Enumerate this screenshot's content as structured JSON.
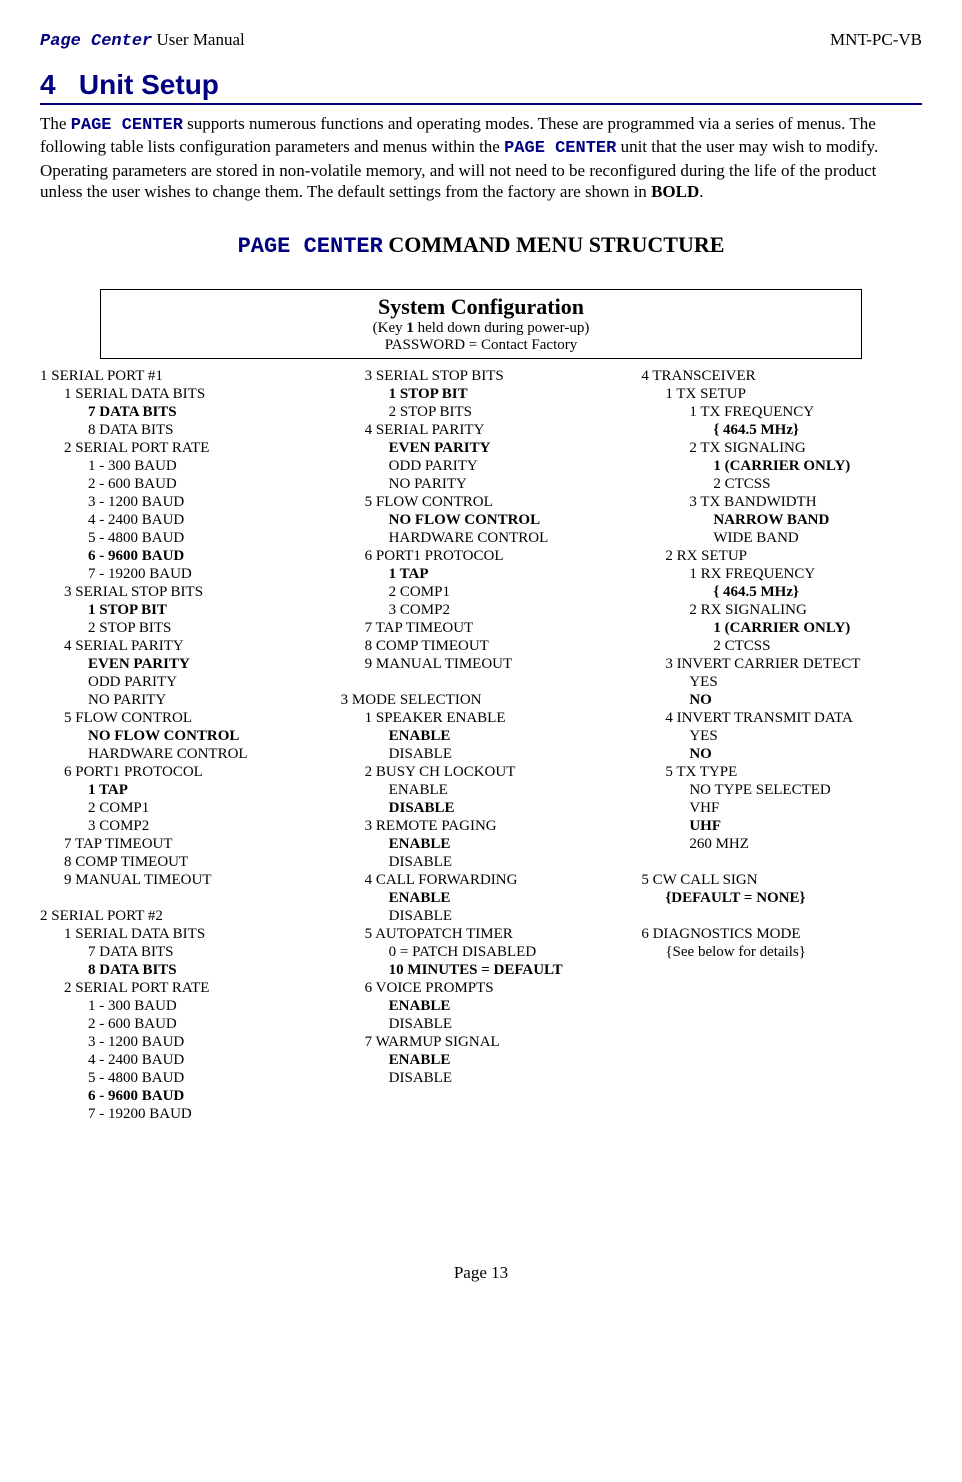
{
  "header": {
    "left_pc": "Page Center",
    "left_rest": " User Manual",
    "right": "MNT-PC-VB"
  },
  "section": {
    "number": "4",
    "title": "Unit Setup"
  },
  "intro": {
    "t1": "The ",
    "pc1": "PAGE CENTER",
    "t2": " supports numerous functions and operating modes.  These are programmed via a series of menus.  The following table lists configuration parameters and menus within the ",
    "pc2": "PAGE CENTER",
    "t3": " unit that the user may wish to modify.  Operating parameters are stored in non-volatile memory, and will not need to be reconfigured during the life of the product unless the user wishes to change them.  The default settings from the factory are shown in ",
    "bold": "BOLD",
    "t4": "."
  },
  "menu_title": {
    "pc": "PAGE CENTER",
    "rest": " COMMAND MENU STRUCTURE"
  },
  "sysconf": {
    "title": "System Configuration",
    "sub1a": "(Key ",
    "sub1b": "1",
    "sub1c": " held down during power-up)",
    "sub2": "PASSWORD = Contact Factory"
  },
  "columns": [
    [
      {
        "lvl": 0,
        "b": 0,
        "t": "1 SERIAL PORT #1"
      },
      {
        "lvl": 1,
        "b": 0,
        "t": "1 SERIAL DATA BITS"
      },
      {
        "lvl": 2,
        "b": 1,
        "t": "7 DATA BITS"
      },
      {
        "lvl": 2,
        "b": 0,
        "t": "8 DATA BITS"
      },
      {
        "lvl": 1,
        "b": 0,
        "t": "2 SERIAL PORT RATE"
      },
      {
        "lvl": 2,
        "b": 0,
        "t": "1 - 300 BAUD"
      },
      {
        "lvl": 2,
        "b": 0,
        "t": "2 - 600 BAUD"
      },
      {
        "lvl": 2,
        "b": 0,
        "t": "3 - 1200 BAUD"
      },
      {
        "lvl": 2,
        "b": 0,
        "t": "4 - 2400 BAUD"
      },
      {
        "lvl": 2,
        "b": 0,
        "t": "5 - 4800 BAUD"
      },
      {
        "lvl": 2,
        "b": 1,
        "t": "6 - 9600 BAUD"
      },
      {
        "lvl": 2,
        "b": 0,
        "t": "7 - 19200 BAUD"
      },
      {
        "lvl": 1,
        "b": 0,
        "t": "3 SERIAL STOP BITS"
      },
      {
        "lvl": 2,
        "b": 1,
        "t": "1 STOP BIT"
      },
      {
        "lvl": 2,
        "b": 0,
        "t": "2 STOP BITS"
      },
      {
        "lvl": 1,
        "b": 0,
        "t": "4 SERIAL PARITY"
      },
      {
        "lvl": 2,
        "b": 1,
        "t": "EVEN PARITY"
      },
      {
        "lvl": 2,
        "b": 0,
        "t": "ODD PARITY"
      },
      {
        "lvl": 2,
        "b": 0,
        "t": "NO PARITY"
      },
      {
        "lvl": 1,
        "b": 0,
        "t": "5 FLOW CONTROL"
      },
      {
        "lvl": 2,
        "b": 1,
        "t": "NO FLOW CONTROL"
      },
      {
        "lvl": 2,
        "b": 0,
        "t": "HARDWARE CONTROL"
      },
      {
        "lvl": 1,
        "b": 0,
        "t": "6 PORT1 PROTOCOL"
      },
      {
        "lvl": 2,
        "b": 1,
        "t": "1 TAP"
      },
      {
        "lvl": 2,
        "b": 0,
        "t": "2 COMP1"
      },
      {
        "lvl": 2,
        "b": 0,
        "t": "3 COMP2"
      },
      {
        "lvl": 1,
        "b": 0,
        "t": "7 TAP TIMEOUT"
      },
      {
        "lvl": 1,
        "b": 0,
        "t": "8 COMP TIMEOUT"
      },
      {
        "lvl": 1,
        "b": 0,
        "t": "9 MANUAL TIMEOUT"
      },
      {
        "lvl": 0,
        "b": 0,
        "t": " "
      },
      {
        "lvl": 0,
        "b": 0,
        "t": "2 SERIAL PORT #2"
      },
      {
        "lvl": 1,
        "b": 0,
        "t": "1 SERIAL DATA BITS"
      },
      {
        "lvl": 2,
        "b": 0,
        "t": "7 DATA BITS"
      },
      {
        "lvl": 2,
        "b": 1,
        "t": "8 DATA BITS"
      },
      {
        "lvl": 1,
        "b": 0,
        "t": "2 SERIAL PORT RATE"
      },
      {
        "lvl": 2,
        "b": 0,
        "t": "1 - 300 BAUD"
      },
      {
        "lvl": 2,
        "b": 0,
        "t": "2 - 600 BAUD"
      },
      {
        "lvl": 2,
        "b": 0,
        "t": "3 - 1200 BAUD"
      },
      {
        "lvl": 2,
        "b": 0,
        "t": "4 - 2400 BAUD"
      },
      {
        "lvl": 2,
        "b": 0,
        "t": "5 - 4800 BAUD"
      },
      {
        "lvl": 2,
        "b": 1,
        "t": "6 - 9600 BAUD"
      },
      {
        "lvl": 2,
        "b": 0,
        "t": "7 - 19200 BAUD"
      }
    ],
    [
      {
        "lvl": 1,
        "b": 0,
        "t": "3 SERIAL STOP BITS"
      },
      {
        "lvl": 2,
        "b": 1,
        "t": "1 STOP BIT"
      },
      {
        "lvl": 2,
        "b": 0,
        "t": "2 STOP BITS"
      },
      {
        "lvl": 1,
        "b": 0,
        "t": "4 SERIAL PARITY"
      },
      {
        "lvl": 2,
        "b": 1,
        "t": "EVEN PARITY"
      },
      {
        "lvl": 2,
        "b": 0,
        "t": "ODD PARITY"
      },
      {
        "lvl": 2,
        "b": 0,
        "t": "NO PARITY"
      },
      {
        "lvl": 1,
        "b": 0,
        "t": "5 FLOW CONTROL"
      },
      {
        "lvl": 2,
        "b": 1,
        "t": "NO FLOW CONTROL"
      },
      {
        "lvl": 2,
        "b": 0,
        "t": "HARDWARE CONTROL"
      },
      {
        "lvl": 1,
        "b": 0,
        "t": "6 PORT1 PROTOCOL"
      },
      {
        "lvl": 2,
        "b": 1,
        "t": "1 TAP"
      },
      {
        "lvl": 2,
        "b": 0,
        "t": "2 COMP1"
      },
      {
        "lvl": 2,
        "b": 0,
        "t": "3 COMP2"
      },
      {
        "lvl": 1,
        "b": 0,
        "t": "7 TAP TIMEOUT"
      },
      {
        "lvl": 1,
        "b": 0,
        "t": "8 COMP TIMEOUT"
      },
      {
        "lvl": 1,
        "b": 0,
        "t": "9 MANUAL TIMEOUT"
      },
      {
        "lvl": 0,
        "b": 0,
        "t": " "
      },
      {
        "lvl": 0,
        "b": 0,
        "t": "3 MODE SELECTION"
      },
      {
        "lvl": 1,
        "b": 0,
        "t": "1 SPEAKER ENABLE"
      },
      {
        "lvl": 2,
        "b": 1,
        "t": "ENABLE"
      },
      {
        "lvl": 2,
        "b": 0,
        "t": "DISABLE"
      },
      {
        "lvl": 1,
        "b": 0,
        "t": "2 BUSY CH LOCKOUT"
      },
      {
        "lvl": 2,
        "b": 0,
        "t": "ENABLE"
      },
      {
        "lvl": 2,
        "b": 1,
        "t": "DISABLE"
      },
      {
        "lvl": 1,
        "b": 0,
        "t": "3 REMOTE PAGING"
      },
      {
        "lvl": 2,
        "b": 1,
        "t": "ENABLE"
      },
      {
        "lvl": 2,
        "b": 0,
        "t": "DISABLE"
      },
      {
        "lvl": 1,
        "b": 0,
        "t": "4 CALL FORWARDING"
      },
      {
        "lvl": 2,
        "b": 1,
        "t": "ENABLE"
      },
      {
        "lvl": 2,
        "b": 0,
        "t": "DISABLE"
      },
      {
        "lvl": 1,
        "b": 0,
        "t": "5 AUTOPATCH TIMER"
      },
      {
        "lvl": 2,
        "b": 0,
        "t": "0 = PATCH DISABLED"
      },
      {
        "lvl": 2,
        "b": 1,
        "t": "10 MINUTES = DEFAULT"
      },
      {
        "lvl": 1,
        "b": 0,
        "t": "6 VOICE PROMPTS"
      },
      {
        "lvl": 2,
        "b": 1,
        "t": "ENABLE"
      },
      {
        "lvl": 2,
        "b": 0,
        "t": "DISABLE"
      },
      {
        "lvl": 1,
        "b": 0,
        "t": "7 WARMUP SIGNAL"
      },
      {
        "lvl": 2,
        "b": 1,
        "t": "ENABLE"
      },
      {
        "lvl": 2,
        "b": 0,
        "t": "DISABLE"
      }
    ],
    [
      {
        "lvl": 0,
        "b": 0,
        "t": "4 TRANSCEIVER"
      },
      {
        "lvl": 1,
        "b": 0,
        "t": "1 TX SETUP"
      },
      {
        "lvl": 2,
        "b": 0,
        "t": "1 TX FREQUENCY"
      },
      {
        "lvl": 3,
        "b": 1,
        "t": "{ 464.5 MHz}"
      },
      {
        "lvl": 2,
        "b": 0,
        "t": "2 TX SIGNALING"
      },
      {
        "lvl": 3,
        "b": 1,
        "t": "1 (CARRIER ONLY)"
      },
      {
        "lvl": 3,
        "b": 0,
        "t": "2 CTCSS"
      },
      {
        "lvl": 2,
        "b": 0,
        "t": "3 TX BANDWIDTH"
      },
      {
        "lvl": 3,
        "b": 1,
        "t": "NARROW BAND"
      },
      {
        "lvl": 3,
        "b": 0,
        "t": "WIDE BAND"
      },
      {
        "lvl": 1,
        "b": 0,
        "t": "2 RX SETUP"
      },
      {
        "lvl": 2,
        "b": 0,
        "t": "1 RX FREQUENCY"
      },
      {
        "lvl": 3,
        "b": 1,
        "t": "{ 464.5 MHz}"
      },
      {
        "lvl": 2,
        "b": 0,
        "t": "2 RX SIGNALING"
      },
      {
        "lvl": 3,
        "b": 1,
        "t": "1 (CARRIER ONLY)"
      },
      {
        "lvl": 3,
        "b": 0,
        "t": "2 CTCSS"
      },
      {
        "lvl": 1,
        "b": 0,
        "t": "3 INVERT CARRIER DETECT"
      },
      {
        "lvl": 2,
        "b": 0,
        "t": "YES"
      },
      {
        "lvl": 2,
        "b": 1,
        "t": "NO"
      },
      {
        "lvl": 1,
        "b": 0,
        "t": "4 INVERT TRANSMIT DATA"
      },
      {
        "lvl": 2,
        "b": 0,
        "t": "YES"
      },
      {
        "lvl": 2,
        "b": 1,
        "t": "NO"
      },
      {
        "lvl": 1,
        "b": 0,
        "t": "5 TX TYPE"
      },
      {
        "lvl": 2,
        "b": 0,
        "t": "NO TYPE SELECTED"
      },
      {
        "lvl": 2,
        "b": 0,
        "t": "VHF"
      },
      {
        "lvl": 2,
        "b": 1,
        "t": "UHF"
      },
      {
        "lvl": 2,
        "b": 0,
        "t": "260 MHZ"
      },
      {
        "lvl": 0,
        "b": 0,
        "t": " "
      },
      {
        "lvl": 0,
        "b": 0,
        "t": "5 CW CALL SIGN"
      },
      {
        "lvl": 1,
        "b": 1,
        "t": "{DEFAULT = NONE}"
      },
      {
        "lvl": 0,
        "b": 0,
        "t": " "
      },
      {
        "lvl": 0,
        "b": 0,
        "t": "6 DIAGNOSTICS MODE"
      },
      {
        "lvl": 1,
        "b": 0,
        "t": "{See below for details}"
      }
    ]
  ],
  "footer": "Page 13"
}
